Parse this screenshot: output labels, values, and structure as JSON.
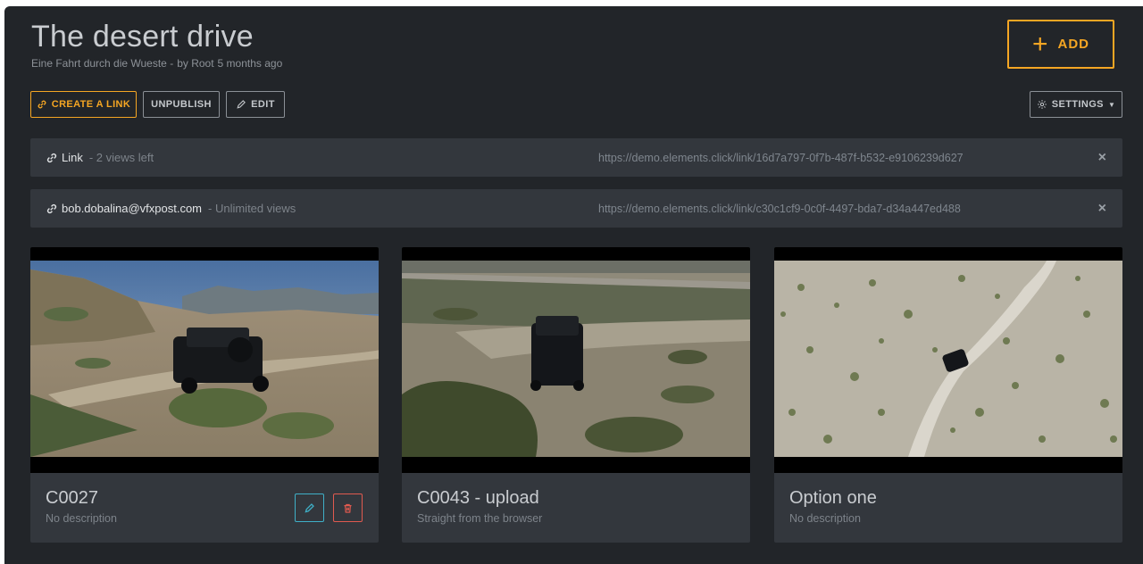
{
  "header": {
    "title": "The desert drive",
    "subtitle_description": "Eine Fahrt durch die Wueste -",
    "subtitle_author": "by Root",
    "subtitle_time": "5 months ago"
  },
  "actions": {
    "add_label": "ADD",
    "create_link_label": "CREATE A LINK",
    "unpublish_label": "UNPUBLISH",
    "edit_label": "EDIT",
    "settings_label": "SETTINGS"
  },
  "links": [
    {
      "name": "Link",
      "views": "- 2 views left",
      "url": "https://demo.elements.click/link/16d7a797-0f7b-487f-b532-e9106239d627"
    },
    {
      "name": "bob.dobalina@vfxpost.com",
      "views": "- Unlimited views",
      "url": "https://demo.elements.click/link/c30c1cf9-0c0f-4497-bda7-d34a447ed488"
    }
  ],
  "clips": [
    {
      "name": "C0027",
      "description": "No description"
    },
    {
      "name": "C0043 - upload",
      "description": "Straight from the browser"
    },
    {
      "name": "Option one",
      "description": "No description"
    }
  ],
  "colors": {
    "accent": "#f5a623",
    "edit": "#3fb0c8",
    "delete": "#e05a4f",
    "background": "#222529",
    "row": "#33373d"
  }
}
